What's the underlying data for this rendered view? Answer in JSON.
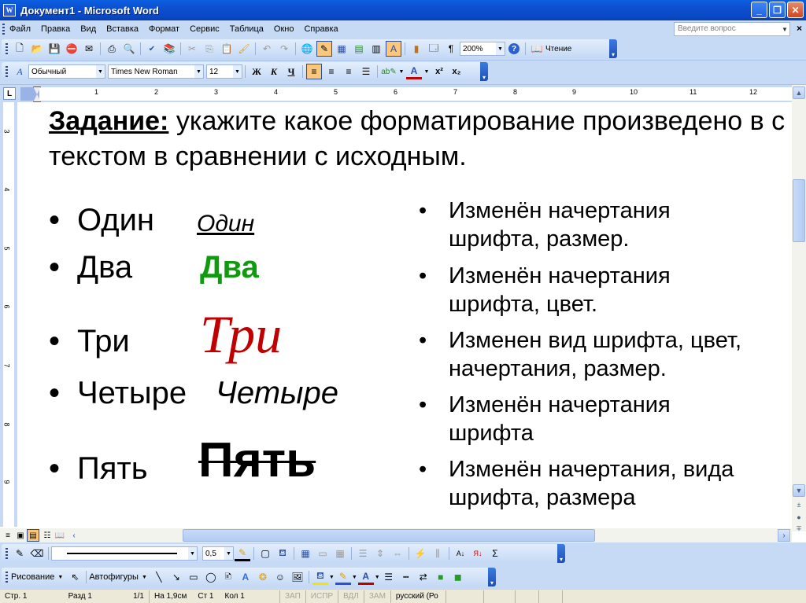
{
  "window": {
    "title": "Документ1 - Microsoft Word",
    "app_icon": "W",
    "buttons": {
      "minimize": "_",
      "restore": "❐",
      "close": "✕"
    }
  },
  "menubar": {
    "items": [
      "Файл",
      "Правка",
      "Вид",
      "Вставка",
      "Формат",
      "Сервис",
      "Таблица",
      "Окно",
      "Справка"
    ],
    "help_placeholder": "Введите вопрос",
    "close_label": "×"
  },
  "standard_toolbar": {
    "icons": [
      "new-document",
      "open",
      "save",
      "permissions",
      "email",
      "print",
      "print-preview",
      "spelling",
      "research",
      "cut",
      "copy",
      "paste",
      "format-painter",
      "undo",
      "redo",
      "hyperlink",
      "tables-borders",
      "insert-table",
      "insert-excel",
      "columns",
      "drawing",
      "document-map",
      "show-hide"
    ],
    "zoom_value": "200%",
    "help_icon": "?",
    "reading_label": "Чтение"
  },
  "formatting_toolbar": {
    "style_value": "Обычный",
    "font_value": "Times New Roman",
    "size_value": "12",
    "bold_label": "Ж",
    "italic_label": "К",
    "underline_label": "Ч",
    "superscript_label": "x²",
    "subscript_label": "x₂"
  },
  "ruler": {
    "tab_selector": "L",
    "numbers": [
      "1",
      "2",
      "3",
      "4",
      "5",
      "6",
      "7",
      "8",
      "9",
      "10",
      "11",
      "12"
    ]
  },
  "vruler": {
    "numbers": [
      "3",
      "4",
      "5",
      "6",
      "7",
      "8",
      "9"
    ]
  },
  "document": {
    "task_label": "Задание:",
    "task_text": " укажите какое форматирование произведено в с текстом в сравнении с исходным.",
    "bullet": "•",
    "left_items": [
      {
        "original": "Один",
        "formatted": "Один"
      },
      {
        "original": "Два",
        "formatted": "Два"
      },
      {
        "original": "Три",
        "formatted": "Три"
      },
      {
        "original": "Четыре",
        "formatted": "Четыре"
      },
      {
        "original": "Пять",
        "formatted": "Пять"
      }
    ],
    "right_items": [
      {
        "line1": "Изменён начертания",
        "line2": "шрифта, размер."
      },
      {
        "line1": "Изменён начертания",
        "line2": "шрифта, цвет."
      },
      {
        "line1": "Изменен вид шрифта, цвет,",
        "line2": "начертания, размер."
      },
      {
        "line1": "Изменён начертания",
        "line2": "шрифта"
      },
      {
        "line1": "Изменён начертания, вида",
        "line2": "шрифта, размера"
      }
    ],
    "colors": {
      "green": "#109a10",
      "red": "#c00000"
    }
  },
  "drawing_toolbar": {
    "line_weight": "0,5",
    "draw_label": "Рисование",
    "autoshapes_label": "Автофигуры"
  },
  "statusbar": {
    "page": "Стр. 1",
    "section": "Разд 1",
    "pages": "1/1",
    "at": "На 1,9см",
    "line": "Ст 1",
    "col": "Кол 1",
    "rec": "ЗАП",
    "trk": "ИСПР",
    "ext": "ВДЛ",
    "ovr": "ЗАМ",
    "language": "русский (Ро"
  }
}
